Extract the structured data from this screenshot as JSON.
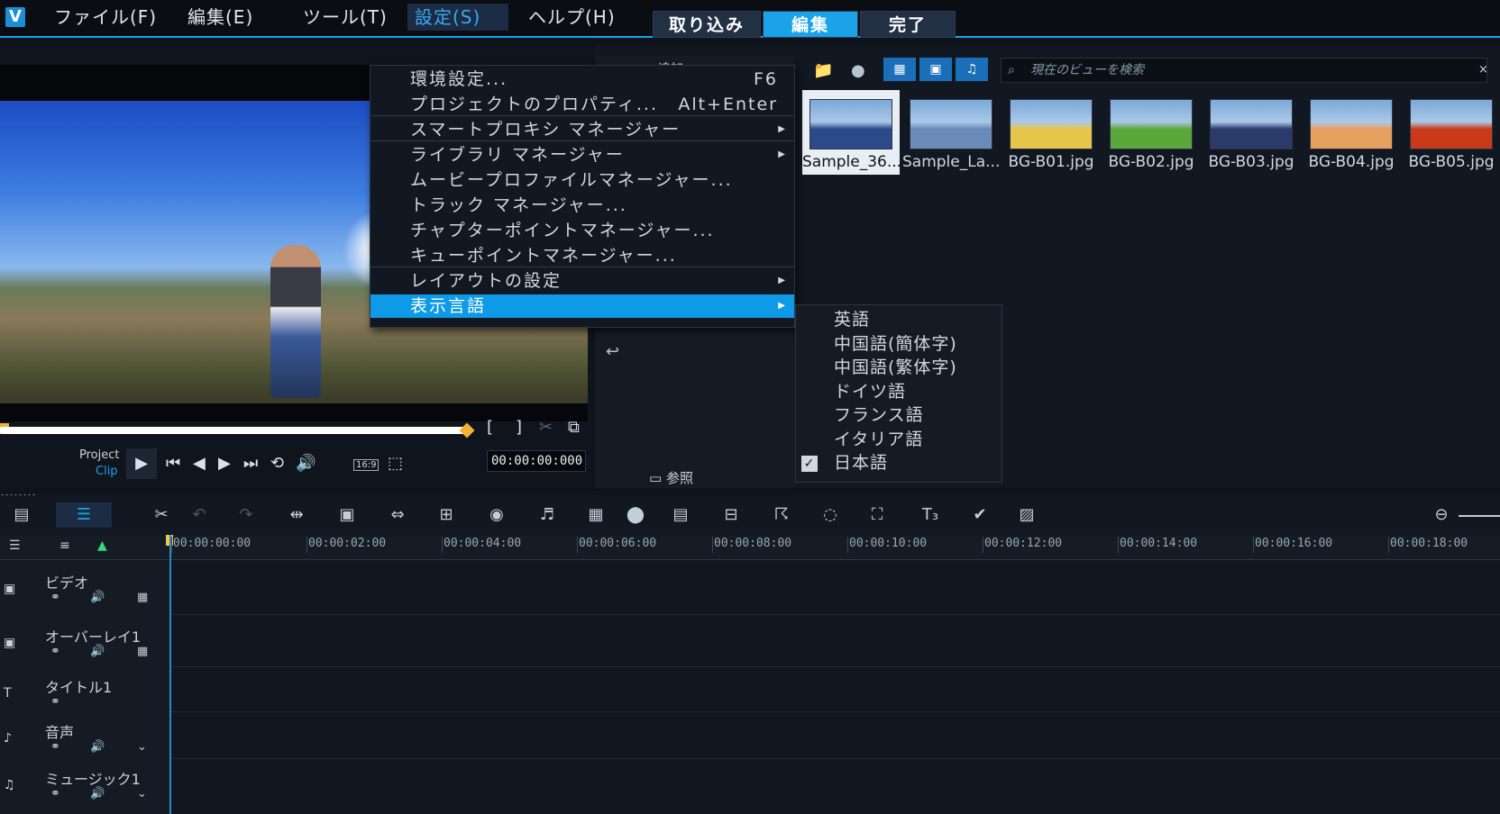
{
  "menubar": {
    "logo": "V",
    "items": [
      "ファイル(F)",
      "編集(E)",
      "ツール(T)",
      "設定(S)",
      "ヘルプ(H)"
    ],
    "tabs": [
      "取り込み",
      "編集",
      "完了"
    ]
  },
  "player": {
    "project_label": "Project",
    "clip_label": "Clip",
    "timecode": "00:00:00:000",
    "aspect": "16:9",
    "mark_in": "[",
    "mark_out": "]"
  },
  "library": {
    "search_placeholder": "現在のビューを検索",
    "left_label_partial": "追加",
    "browse_label": "参照",
    "close": "×",
    "thumbnails": [
      {
        "caption": "Sample_36...",
        "color": "#2a4a8a"
      },
      {
        "caption": "Sample_La...",
        "color": "#6a8ab8"
      },
      {
        "caption": "BG-B01.jpg",
        "color": "#e6c64a"
      },
      {
        "caption": "BG-B02.jpg",
        "color": "#5aa83a"
      },
      {
        "caption": "BG-B03.jpg",
        "color": "#2a3a6a"
      },
      {
        "caption": "BG-B04.jpg",
        "color": "#e6a060"
      },
      {
        "caption": "BG-B05.jpg",
        "color": "#c83a1a"
      }
    ]
  },
  "settings_menu": {
    "items": [
      {
        "label": "環境設定...",
        "shortcut": "F6"
      },
      {
        "label": "プロジェクトのプロパティ...",
        "shortcut": "Alt+Enter"
      },
      {
        "label": "スマートプロキシ マネージャー",
        "submenu": true
      },
      {
        "label": "ライブラリ マネージャー",
        "submenu": true
      },
      {
        "label": "ムービープロファイルマネージャー..."
      },
      {
        "label": "トラック マネージャー..."
      },
      {
        "label": "チャプターポイントマネージャー..."
      },
      {
        "label": "キューポイントマネージャー..."
      },
      {
        "label": "レイアウトの設定",
        "submenu": true
      },
      {
        "label": "表示言語",
        "submenu": true
      }
    ]
  },
  "language_menu": {
    "items": [
      "英語",
      "中国語(簡体字)",
      "中国語(繁体字)",
      "ドイツ語",
      "フランス語",
      "イタリア語",
      "日本語"
    ],
    "checked_index": 6,
    "check_mark": "✓"
  },
  "timeline": {
    "ticks": [
      "00:00:00:00",
      "00:00:02:00",
      "00:00:04:00",
      "00:00:06:00",
      "00:00:08:00",
      "00:00:10:00",
      "00:00:12:00",
      "00:00:14:00",
      "00:00:16:00",
      "00:00:18:00"
    ],
    "tracks": [
      "ビデオ",
      "オーバーレイ1",
      "タイトル1",
      "音声",
      "ミュージック1"
    ]
  }
}
